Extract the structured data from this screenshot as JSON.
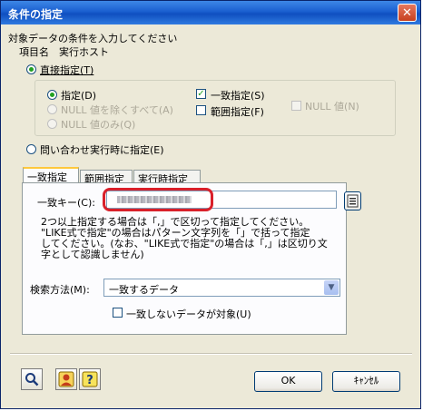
{
  "window": {
    "title": "条件の指定",
    "close_glyph": "✕"
  },
  "header": {
    "instruction": "対象データの条件を入力してください",
    "item_label": "項目名",
    "item_value": "実行ホスト"
  },
  "direct": {
    "label": "直接指定(T)",
    "specify": "指定(D)",
    "exclude_null": "NULL 値を除くすべて(A)",
    "only_null": "NULL 値のみ(Q)",
    "exact": "一致指定(S)",
    "range": "範囲指定(F)",
    "null_value": "NULL 値(N)"
  },
  "query": {
    "label": "問い合わせ実行時に指定(E)"
  },
  "tabs": [
    "一致指定",
    "範囲指定",
    "実行時指定"
  ],
  "exact_tab": {
    "key_label": "一致キー(C):",
    "key_value": "",
    "help": [
      "2つ以上指定する場合は「,」で区切って指定してください。",
      "\"LIKE式で指定\"の場合はパターン文字列を「」で括って指定",
      "してください。(なお、\"LIKE式で指定\"の場合は「,」は区切り文",
      "字として認識しません)"
    ]
  },
  "search": {
    "label": "検索方法(M):",
    "selected": "一致するデータ",
    "mismatch_label": "一致しないデータが対象(U)"
  },
  "footer": {
    "ok": "OK",
    "cancel": "ｷｬﾝｾﾙ"
  },
  "colors": {
    "accent": "#d9202a",
    "title_bar": "#1a5fd0",
    "check": "#21a121"
  }
}
